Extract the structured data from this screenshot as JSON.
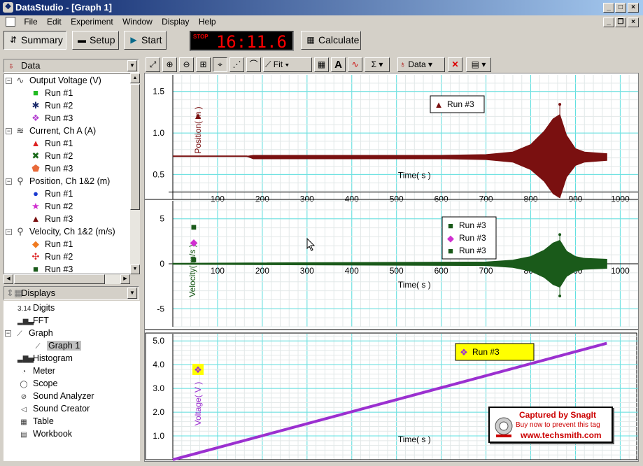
{
  "window": {
    "title": "DataStudio - [Graph 1]"
  },
  "menu": [
    "File",
    "Edit",
    "Experiment",
    "Window",
    "Display",
    "Help"
  ],
  "controls": {
    "summary": "Summary",
    "setup": "Setup",
    "start": "Start",
    "timer_label": "STOP",
    "timer_value": "16:11.6",
    "calculate": "Calculate"
  },
  "data_panel": {
    "title": "Data",
    "groups": [
      {
        "label": "Output Voltage (V)",
        "runs": [
          {
            "label": "Run #1",
            "symbol": "■",
            "color": "#22bb22"
          },
          {
            "label": "Run #2",
            "symbol": "✱",
            "color": "#1a2a6a"
          },
          {
            "label": "Run #3",
            "symbol": "❖",
            "color": "#b23fd0"
          }
        ]
      },
      {
        "label": "Current, Ch A (A)",
        "runs": [
          {
            "label": "Run #1",
            "symbol": "▲",
            "color": "#dd2222"
          },
          {
            "label": "Run #2",
            "symbol": "✖",
            "color": "#1a6a1a"
          },
          {
            "label": "Run #3",
            "symbol": "⬟",
            "color": "#e86a3a"
          }
        ]
      },
      {
        "label": "Position, Ch 1&2 (m)",
        "runs": [
          {
            "label": "Run #1",
            "symbol": "●",
            "color": "#1a3ad0"
          },
          {
            "label": "Run #2",
            "symbol": "★",
            "color": "#d030d0"
          },
          {
            "label": "Run #3",
            "symbol": "▲",
            "color": "#7a1010"
          }
        ]
      },
      {
        "label": "Velocity, Ch 1&2 (m/s)",
        "runs": [
          {
            "label": "Run #1",
            "symbol": "◆",
            "color": "#f07a20"
          },
          {
            "label": "Run #2",
            "symbol": "✣",
            "color": "#dd2222"
          },
          {
            "label": "Run #3",
            "symbol": "■",
            "color": "#1a5a1a"
          }
        ]
      }
    ]
  },
  "displays_panel": {
    "title": "Displays",
    "items": [
      {
        "label": "Digits",
        "icon": "digits-icon",
        "glyph": "3.14"
      },
      {
        "label": "FFT",
        "icon": "fft-icon",
        "glyph": "▂▆▃"
      },
      {
        "label": "Graph",
        "icon": "graph-icon",
        "glyph": "⟋"
      },
      {
        "label": "Graph 1",
        "icon": "graph-icon",
        "glyph": "⟋"
      },
      {
        "label": "Histogram",
        "icon": "histogram-icon",
        "glyph": "▃▇▅"
      },
      {
        "label": "Meter",
        "icon": "meter-icon",
        "glyph": "◔"
      },
      {
        "label": "Scope",
        "icon": "scope-icon",
        "glyph": "◯"
      },
      {
        "label": "Sound Analyzer",
        "icon": "sound-analyzer-icon",
        "glyph": "⊘"
      },
      {
        "label": "Sound Creator",
        "icon": "sound-creator-icon",
        "glyph": "◁"
      },
      {
        "label": "Table",
        "icon": "table-icon",
        "glyph": "▦"
      },
      {
        "label": "Workbook",
        "icon": "workbook-icon",
        "glyph": "▤"
      }
    ]
  },
  "graph_toolbar": {
    "fit": "Fit",
    "data": "Data"
  },
  "colors": {
    "position": "#7a1010",
    "velocity": "#1a5a1a",
    "voltage": "#9b30d0",
    "grid": "#5ee0e0",
    "accent": "#0a246a"
  },
  "chart_data": [
    {
      "type": "line",
      "xlabel": "Time( s )",
      "ylabel": "Position( m )",
      "xticks": [
        100,
        200,
        300,
        400,
        500,
        600,
        700,
        800,
        900,
        1000
      ],
      "yticks": [
        0.5,
        1.0,
        1.5
      ],
      "ylim": [
        0.2,
        1.7
      ],
      "legend": [
        {
          "name": "Run #3",
          "symbol": "▲"
        }
      ],
      "series": [
        {
          "name": "Run #3",
          "color": "#7a1010",
          "x": [
            0,
            165,
            180,
            600,
            700,
            760,
            800,
            830,
            850,
            865,
            880,
            900,
            920,
            970
          ],
          "y": [
            0.72,
            0.72,
            0.71,
            0.71,
            0.71,
            0.71,
            0.71,
            0.72,
            0.72,
            0.72,
            0.72,
            0.71,
            0.71,
            0.71
          ],
          "amplitude": [
            0,
            0,
            0.02,
            0.02,
            0.03,
            0.06,
            0.15,
            0.3,
            0.45,
            0.5,
            0.25,
            0.1,
            0.06,
            0.04
          ]
        }
      ]
    },
    {
      "type": "line",
      "xlabel": "Time( s )",
      "ylabel": "Velocity( m/s )",
      "xticks": [
        100,
        200,
        300,
        400,
        500,
        600,
        700,
        800,
        900,
        1000
      ],
      "yticks": [
        -5,
        0,
        5
      ],
      "ylim": [
        -7,
        7
      ],
      "legend": [
        {
          "name": "Run #3",
          "symbol": "■"
        },
        {
          "name": "Run #3",
          "symbol": "◆"
        },
        {
          "name": "Run #3",
          "symbol": "■"
        }
      ],
      "series": [
        {
          "name": "Run #3",
          "color": "#1a5a1a",
          "x": [
            0,
            700,
            760,
            800,
            830,
            850,
            865,
            880,
            900,
            920,
            970
          ],
          "y": [
            0,
            0,
            0,
            0,
            0,
            0,
            0,
            0,
            0,
            0,
            0
          ],
          "amplitude": [
            0.05,
            0.2,
            0.4,
            0.8,
            1.5,
            2.3,
            2.6,
            1.4,
            0.8,
            0.6,
            0.5
          ]
        }
      ]
    },
    {
      "type": "line",
      "xlabel": "Time( s )",
      "ylabel": "Voltage( V )",
      "xticks": [
        100,
        200,
        300,
        400,
        500,
        600,
        700,
        800,
        900,
        1000
      ],
      "yticks": [
        1.0,
        2.0,
        3.0,
        4.0,
        5.0
      ],
      "ylim": [
        0,
        5.3
      ],
      "legend": [
        {
          "name": "Run #3",
          "symbol": "❖"
        }
      ],
      "series": [
        {
          "name": "Run #3",
          "color": "#9b30d0",
          "x": [
            0,
            970
          ],
          "y": [
            0.0,
            4.9
          ]
        }
      ]
    }
  ],
  "watermark": {
    "line1": "Captured by SnagIt",
    "line2": "Buy now to prevent this tag",
    "line3": "www.techsmith.com"
  }
}
